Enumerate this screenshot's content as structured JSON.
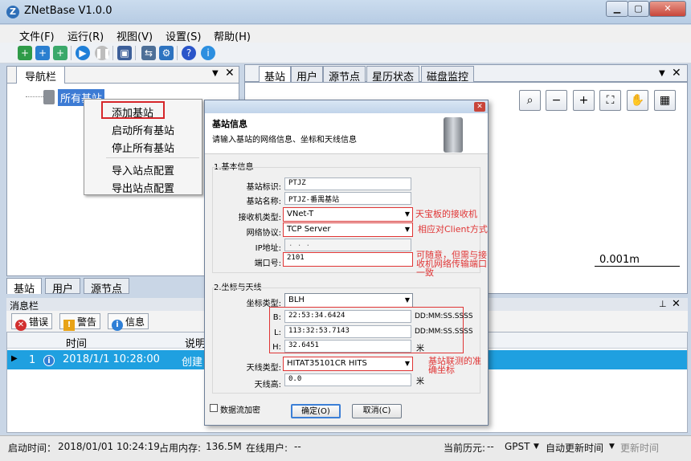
{
  "app": {
    "title": "ZNetBase V1.0.0"
  },
  "menu": [
    "文件(F)",
    "运行(R)",
    "视图(V)",
    "设置(S)",
    "帮助(H)"
  ],
  "nav": {
    "title": "导航栏",
    "root": "所有基站",
    "bottom_tabs": [
      "基站",
      "用户",
      "源节点"
    ]
  },
  "context_menu": [
    "添加基站",
    "启动所有基站",
    "停止所有基站",
    "导入站点配置",
    "导出站点配置"
  ],
  "main_tabs": [
    "基站",
    "用户",
    "源节点",
    "星历状态",
    "磁盘监控"
  ],
  "map": {
    "scale": "0.001m"
  },
  "messages": {
    "title": "消息栏",
    "buttons": [
      "错误",
      "警告",
      "信息"
    ],
    "columns": [
      "时间",
      "说明"
    ],
    "row": {
      "num": "1",
      "time": "2018/1/1 10:28:00",
      "desc": "创建"
    }
  },
  "status": {
    "start_label": "启动时间：",
    "start_value": "2018/01/01 10:24:19",
    "mem_label": "占用内存:",
    "mem_value": "136.5M",
    "users_label": "在线用户:",
    "users_value": "--",
    "epoch_label": "当前历元:",
    "epoch_value": "--",
    "gpst": "GPST",
    "auto": "自动更新时间",
    "update": "更新时间"
  },
  "dialog": {
    "header_title": "基站信息",
    "header_sub": "请输入基站的网络信息、坐标和天线信息",
    "group1": "1.基本信息",
    "group2": "2.坐标与天线",
    "fields": {
      "id_label": "基站标识:",
      "id_value": "PTJZ",
      "name_label": "基站名称:",
      "name_value": "PTJZ-番禺基站",
      "receiver_label": "接收机类型:",
      "receiver_value": "VNet-T",
      "protocol_label": "网络协议:",
      "protocol_value": "TCP Server",
      "ip_label": "IP地址:",
      "ip_value": ".       .       .",
      "port_label": "端口号:",
      "port_value": "2101",
      "coord_label": "坐标类型:",
      "coord_value": "BLH",
      "b_label": "B:",
      "b_value": "22:53:34.6424",
      "l_label": "L:",
      "l_value": "113:32:53.7143",
      "h_label": "H:",
      "h_value": "32.6451",
      "dms1": "DD:MM:SS.SSSS",
      "dms2": "DD:MM:SS.SSSS",
      "unit_m": "米",
      "antenna_label": "天线类型:",
      "antenna_value": "HITAT35101CR    HITS",
      "ant_height_label": "天线高:",
      "ant_height_value": "0.0",
      "unit_m2": "米",
      "encrypt_label": "数据流加密"
    },
    "ok": "确定(O)",
    "cancel": "取消(C)",
    "notes": {
      "receiver": "天宝板的接收机",
      "protocol": "相应对Client方式",
      "port": "可随意，但需与接收机网络传输端口一致",
      "coords": "基站联测的准确坐标"
    }
  }
}
